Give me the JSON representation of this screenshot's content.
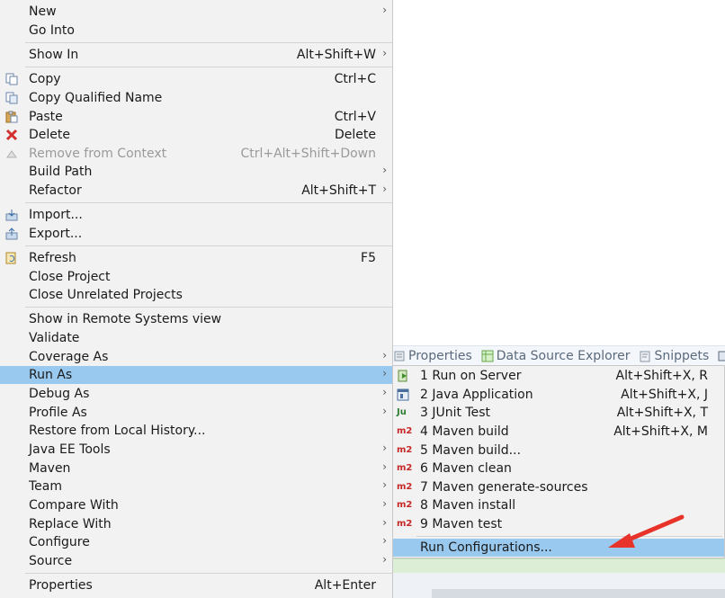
{
  "background": {
    "view_tabs": [
      {
        "icon": "properties-icon",
        "label": "Properties"
      },
      {
        "icon": "data-source-explorer-icon",
        "label": "Data Source Explorer"
      },
      {
        "icon": "snippets-icon",
        "label": "Snippets"
      },
      {
        "icon": "console-icon",
        "label": ""
      }
    ]
  },
  "menu": {
    "items": [
      {
        "label": "New",
        "shortcut": "",
        "submenu": true
      },
      {
        "label": "Go Into",
        "shortcut": ""
      },
      {
        "label": "Show In",
        "shortcut": "Alt+Shift+W",
        "submenu": true
      },
      {
        "label": "Copy",
        "shortcut": "Ctrl+C",
        "icon": "copy-icon"
      },
      {
        "label": "Copy Qualified Name",
        "shortcut": "",
        "icon": "copy-qualified-name-icon"
      },
      {
        "label": "Paste",
        "shortcut": "Ctrl+V",
        "icon": "paste-icon"
      },
      {
        "label": "Delete",
        "shortcut": "Delete",
        "icon": "delete-icon"
      },
      {
        "label": "Remove from Context",
        "shortcut": "Ctrl+Alt+Shift+Down",
        "icon": "remove-context-icon",
        "disabled": true
      },
      {
        "label": "Build Path",
        "shortcut": "",
        "submenu": true
      },
      {
        "label": "Refactor",
        "shortcut": "Alt+Shift+T",
        "submenu": true
      },
      {
        "label": "Import...",
        "shortcut": "",
        "icon": "import-icon"
      },
      {
        "label": "Export...",
        "shortcut": "",
        "icon": "export-icon"
      },
      {
        "label": "Refresh",
        "shortcut": "F5",
        "icon": "refresh-icon"
      },
      {
        "label": "Close Project",
        "shortcut": ""
      },
      {
        "label": "Close Unrelated Projects",
        "shortcut": ""
      },
      {
        "label": "Show in Remote Systems view",
        "shortcut": ""
      },
      {
        "label": "Validate",
        "shortcut": ""
      },
      {
        "label": "Coverage As",
        "shortcut": "",
        "submenu": true
      },
      {
        "label": "Run As",
        "shortcut": "",
        "submenu": true,
        "active": true
      },
      {
        "label": "Debug As",
        "shortcut": "",
        "submenu": true
      },
      {
        "label": "Profile As",
        "shortcut": "",
        "submenu": true
      },
      {
        "label": "Restore from Local History...",
        "shortcut": ""
      },
      {
        "label": "Java EE Tools",
        "shortcut": "",
        "submenu": true
      },
      {
        "label": "Maven",
        "shortcut": "",
        "submenu": true
      },
      {
        "label": "Team",
        "shortcut": "",
        "submenu": true
      },
      {
        "label": "Compare With",
        "shortcut": "",
        "submenu": true
      },
      {
        "label": "Replace With",
        "shortcut": "",
        "submenu": true
      },
      {
        "label": "Configure",
        "shortcut": "",
        "submenu": true
      },
      {
        "label": "Source",
        "shortcut": "",
        "submenu": true
      },
      {
        "label": "Properties",
        "shortcut": "Alt+Enter"
      }
    ],
    "submenu_arrow": "›"
  },
  "run_as_submenu": {
    "items": [
      {
        "label": "1 Run on Server",
        "shortcut": "Alt+Shift+X, R",
        "icon": "run-on-server-icon"
      },
      {
        "label": "2 Java Application",
        "shortcut": "Alt+Shift+X, J",
        "icon": "java-application-icon"
      },
      {
        "label": "3 JUnit Test",
        "shortcut": "Alt+Shift+X, T",
        "icon": "junit-icon",
        "badge": "Ju"
      },
      {
        "label": "4 Maven build",
        "shortcut": "Alt+Shift+X, M",
        "icon": "maven-icon",
        "badge": "m2"
      },
      {
        "label": "5 Maven build...",
        "shortcut": "",
        "icon": "maven-icon",
        "badge": "m2"
      },
      {
        "label": "6 Maven clean",
        "shortcut": "",
        "icon": "maven-icon",
        "badge": "m2"
      },
      {
        "label": "7 Maven generate-sources",
        "shortcut": "",
        "icon": "maven-icon",
        "badge": "m2"
      },
      {
        "label": "8 Maven install",
        "shortcut": "",
        "icon": "maven-icon",
        "badge": "m2"
      },
      {
        "label": "9 Maven test",
        "shortcut": "",
        "icon": "maven-icon",
        "badge": "m2"
      },
      {
        "label": "Run Configurations...",
        "shortcut": "",
        "active": true
      }
    ]
  },
  "colors": {
    "menu_bg": "#f2f2f2",
    "highlight": "#99c9ef",
    "annotation_arrow": "#e8332a"
  }
}
